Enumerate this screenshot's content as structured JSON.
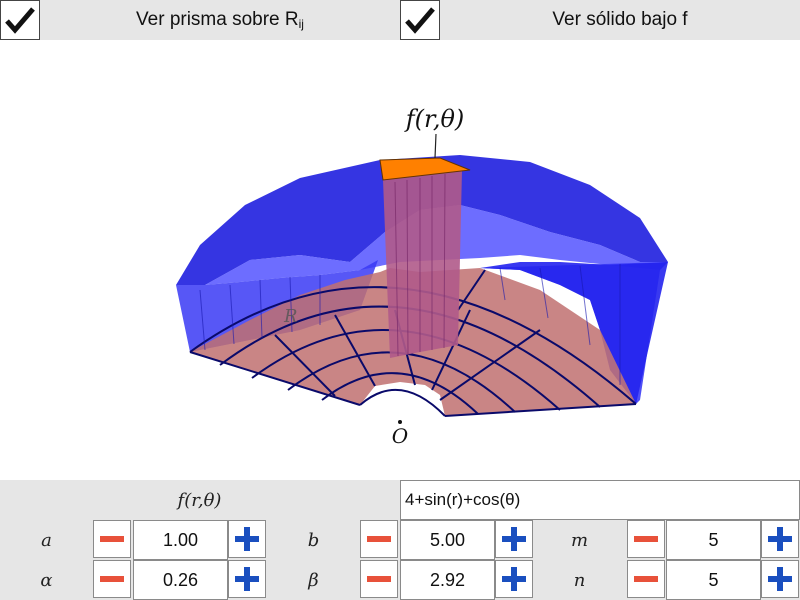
{
  "toggles": [
    {
      "label": "Ver prisma sobre R",
      "subscript": "ij",
      "checked": true
    },
    {
      "label": "Ver sólido bajo f",
      "checked": true
    }
  ],
  "scene": {
    "function_label": "f(r,θ)",
    "region_label": "R",
    "origin_label": "O",
    "colors": {
      "solid": "#1f1fff",
      "region": "#c07070",
      "prism_top": "#ff8000",
      "grid": "#0a0a6a"
    }
  },
  "controls": {
    "function_label": "f(r,θ)",
    "function_value": "4+sin(r)+cos(θ)",
    "params": [
      {
        "name": "a",
        "value": "1.00"
      },
      {
        "name": "b",
        "value": "5.00"
      },
      {
        "name": "m",
        "value": "5"
      },
      {
        "name": "α",
        "value": "0.26"
      },
      {
        "name": "β",
        "value": "2.92"
      },
      {
        "name": "n",
        "value": "5"
      }
    ]
  }
}
